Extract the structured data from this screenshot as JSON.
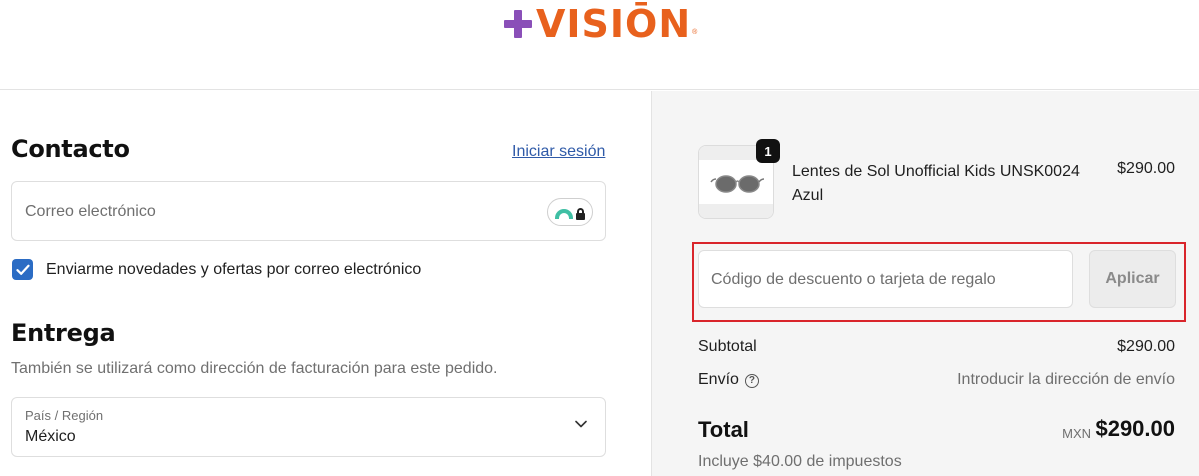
{
  "brand": {
    "logo_text": "VISIŌN",
    "reg_mark": "®",
    "plus_color": "#8a4fb8",
    "text_color": "#e8611d"
  },
  "contact": {
    "heading": "Contacto",
    "login_link": "Iniciar sesión",
    "email_placeholder": "Correo electrónico",
    "newsletter_label": "Enviarme novedades y ofertas por correo electrónico",
    "newsletter_checked": true
  },
  "delivery": {
    "heading": "Entrega",
    "subtext": "También se utilizará como dirección de facturación para este pedido.",
    "country_label": "País / Región",
    "country_value": "México"
  },
  "summary": {
    "item": {
      "quantity": "1",
      "name": "Lentes de Sol Unofficial Kids UNSK0024 Azul",
      "price": "$290.00",
      "icon": "sunglasses-icon"
    },
    "discount_placeholder": "Código de descuento o tarjeta de regalo",
    "apply_label": "Aplicar",
    "subtotal_label": "Subtotal",
    "subtotal_value": "$290.00",
    "shipping_label": "Envío",
    "shipping_value": "Introducir la dirección de envío",
    "total_label": "Total",
    "currency": "MXN",
    "total_value": "$290.00",
    "tax_note": "Incluye $40.00 de impuestos"
  },
  "colors": {
    "accent": "#2b6cc4",
    "link": "#2f5aa8",
    "highlight": "#d9252b",
    "summary_bg": "#f5f5f5"
  }
}
